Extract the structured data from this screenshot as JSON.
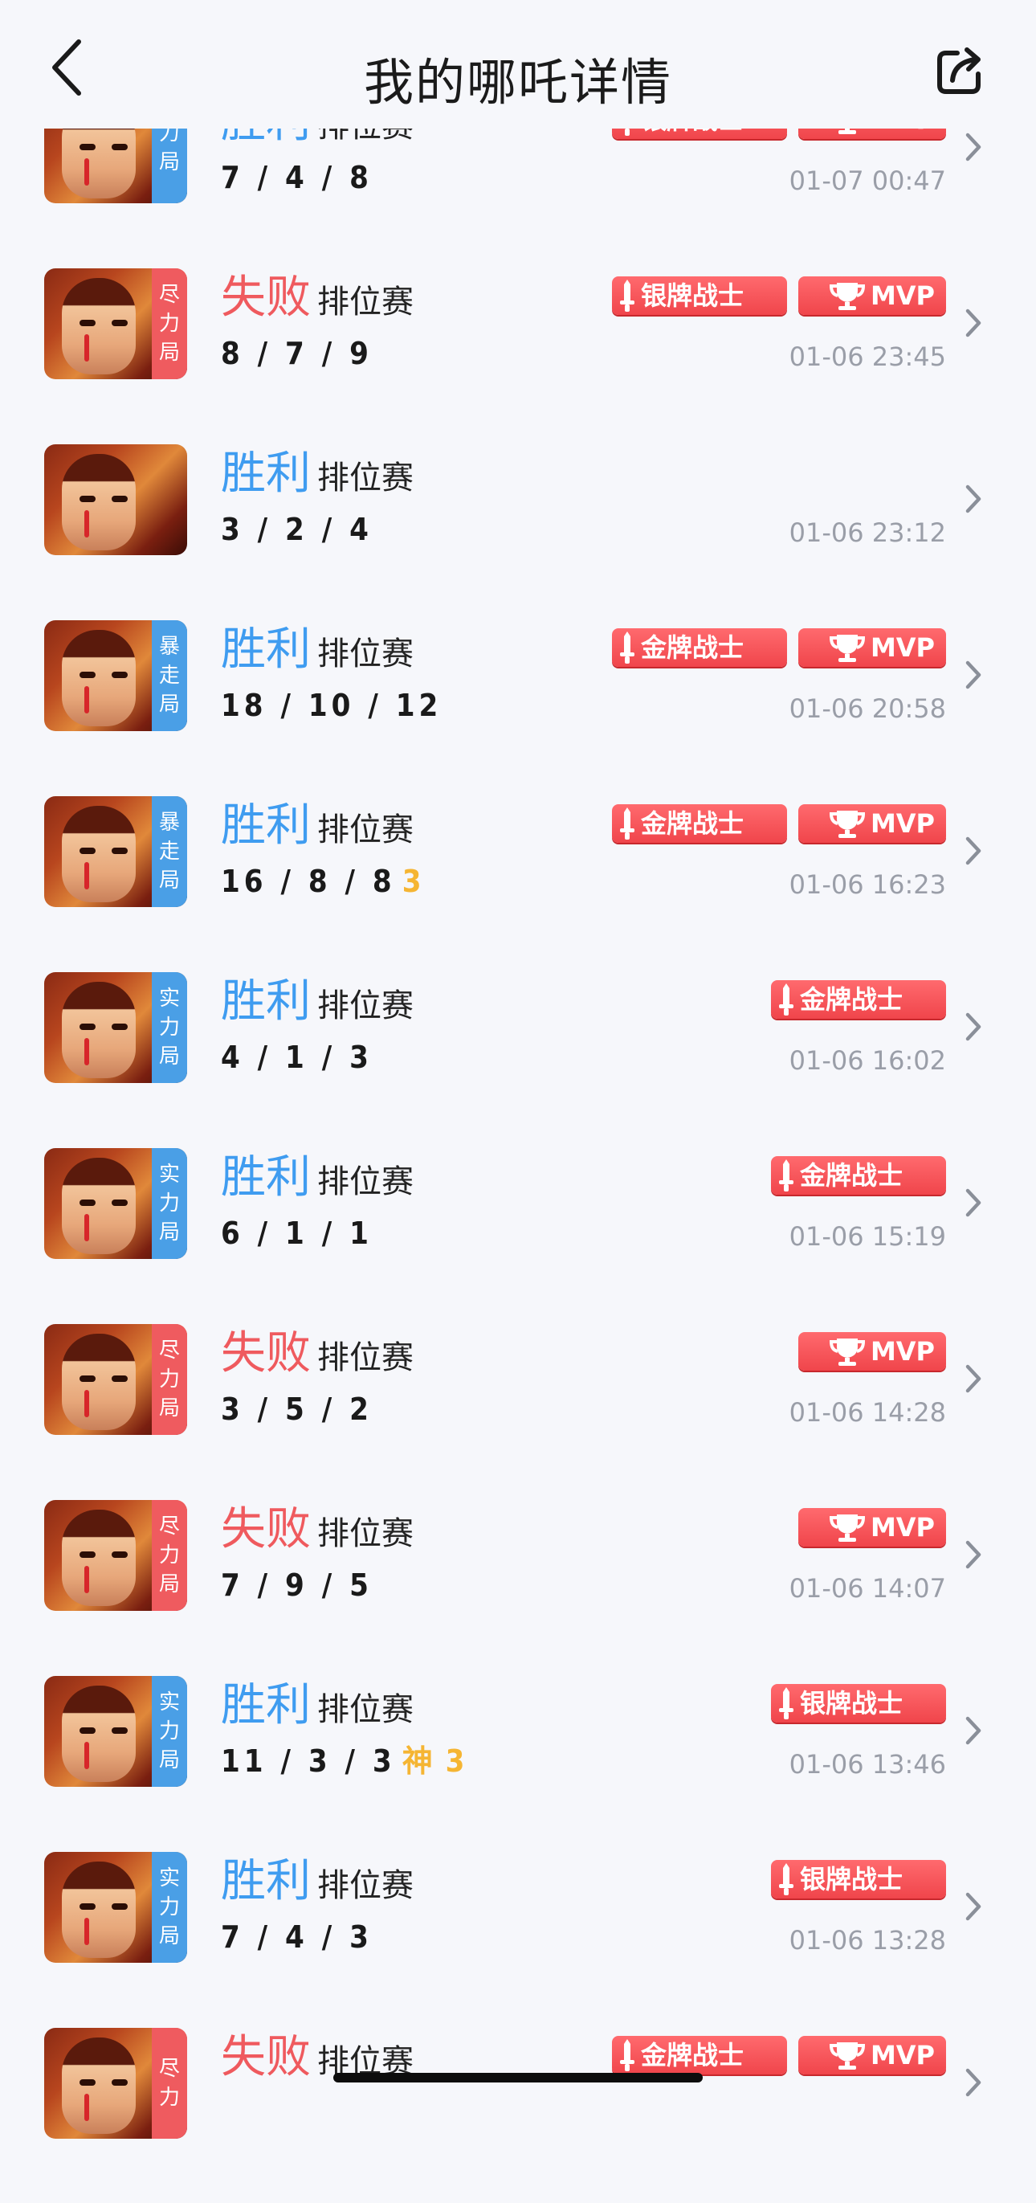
{
  "header": {
    "title": "我的哪吒详情"
  },
  "colors": {
    "win": "#3f9cf0",
    "lose": "#ef5a5e",
    "badge": "#f0454b",
    "tag_red": "#ef5b5f",
    "tag_blue": "#4a9fe6",
    "streak": "#f5b533"
  },
  "rows": [
    {
      "result": "胜利",
      "mode": "排位赛",
      "kda": "7 / 4 / 8",
      "extra": "",
      "time": "01-07 00:47",
      "tag": [
        "力",
        "局"
      ],
      "badges": [
        "银牌战士",
        "MVP"
      ]
    },
    {
      "result": "失败",
      "mode": "排位赛",
      "kda": "8 / 7 / 9",
      "extra": "",
      "time": "01-06 23:45",
      "tag": [
        "尽",
        "力",
        "局"
      ],
      "badges": [
        "银牌战士",
        "MVP"
      ]
    },
    {
      "result": "胜利",
      "mode": "排位赛",
      "kda": "3 / 2 / 4",
      "extra": "",
      "time": "01-06 23:12",
      "tag": [],
      "badges": []
    },
    {
      "result": "胜利",
      "mode": "排位赛",
      "kda": "18 / 10 / 12",
      "extra": "",
      "time": "01-06 20:58",
      "tag": [
        "暴",
        "走",
        "局"
      ],
      "badges": [
        "金牌战士",
        "MVP"
      ]
    },
    {
      "result": "胜利",
      "mode": "排位赛",
      "kda": "16 / 8 / 8",
      "extra": "3",
      "time": "01-06 16:23",
      "tag": [
        "暴",
        "走",
        "局"
      ],
      "badges": [
        "金牌战士",
        "MVP"
      ]
    },
    {
      "result": "胜利",
      "mode": "排位赛",
      "kda": "4 / 1 / 3",
      "extra": "",
      "time": "01-06 16:02",
      "tag": [
        "实",
        "力",
        "局"
      ],
      "badges": [
        "金牌战士"
      ]
    },
    {
      "result": "胜利",
      "mode": "排位赛",
      "kda": "6 / 1 / 1",
      "extra": "",
      "time": "01-06 15:19",
      "tag": [
        "实",
        "力",
        "局"
      ],
      "badges": [
        "金牌战士"
      ]
    },
    {
      "result": "失败",
      "mode": "排位赛",
      "kda": "3 / 5 / 2",
      "extra": "",
      "time": "01-06 14:28",
      "tag": [
        "尽",
        "力",
        "局"
      ],
      "badges": [
        "MVP"
      ]
    },
    {
      "result": "失败",
      "mode": "排位赛",
      "kda": "7 / 9 / 5",
      "extra": "",
      "time": "01-06 14:07",
      "tag": [
        "尽",
        "力",
        "局"
      ],
      "badges": [
        "MVP"
      ]
    },
    {
      "result": "胜利",
      "mode": "排位赛",
      "kda": "11 / 3 / 3",
      "extra": "神 3",
      "time": "01-06 13:46",
      "tag": [
        "实",
        "力",
        "局"
      ],
      "badges": [
        "银牌战士"
      ]
    },
    {
      "result": "胜利",
      "mode": "排位赛",
      "kda": "7 / 4 / 3",
      "extra": "",
      "time": "01-06 13:28",
      "tag": [
        "实",
        "力",
        "局"
      ],
      "badges": [
        "银牌战士"
      ]
    },
    {
      "result": "失败",
      "mode": "排位赛",
      "kda": "",
      "extra": "",
      "time": "",
      "tag": [
        "尽",
        "力"
      ],
      "badges": [
        "金牌战士",
        "MVP"
      ]
    }
  ]
}
